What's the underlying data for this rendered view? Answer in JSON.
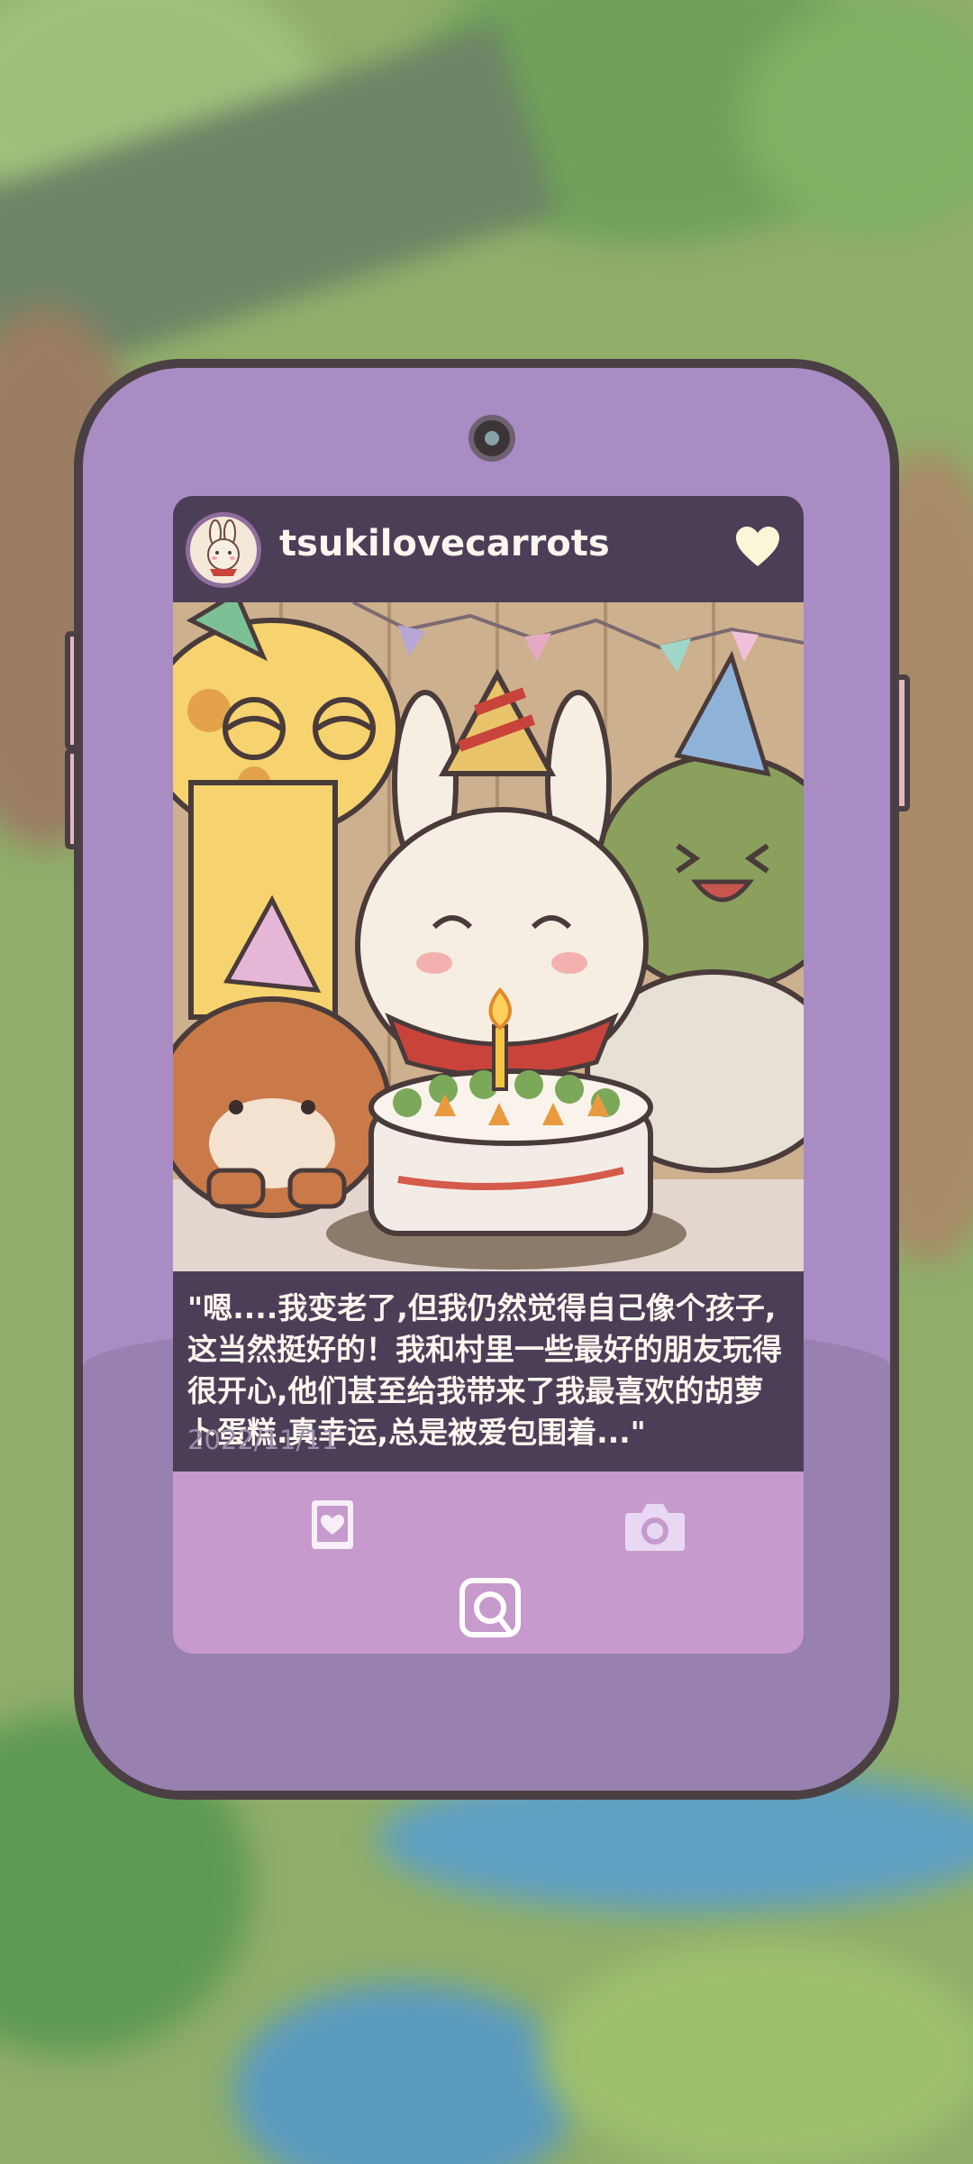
{
  "profile": {
    "username": "tsukilovecarrots"
  },
  "post": {
    "caption": "\"嗯....我变老了,但我仍然觉得自己像个孩子,这当然挺好的！我和村里一些最好的朋友玩得很开心,他们甚至给我带来了我最喜欢的胡萝卜蛋糕.真幸运,总是被爱包围着...\"",
    "date": "2022/11/11",
    "image_description_icon": "birthday-party-photo"
  },
  "icons": {
    "like": "heart-icon",
    "album": "album-icon",
    "camera": "camera-icon",
    "home": "home-icon"
  },
  "colors": {
    "phone_body": "#a98cc4",
    "screen_bg": "#c69acc",
    "header_bg": "#4b3f57",
    "text_light": "#fbf6ee",
    "date_text": "#9b8aa8"
  }
}
